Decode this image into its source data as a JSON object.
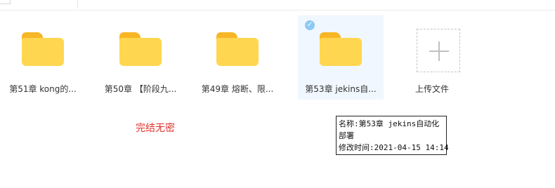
{
  "items": [
    {
      "label": "第51章 kong的..."
    },
    {
      "label": "第50章 【阶段九..."
    },
    {
      "label": "第49章 熔断、限..."
    },
    {
      "label": "第53章 jekins自...",
      "selected": true
    }
  ],
  "upload": {
    "label": "上传文件"
  },
  "note": "完结无密",
  "tooltip": {
    "name_line1": "名称:第53章 jekins自动化",
    "name_line2": "部署",
    "modified": "修改时间:2021-04-15 14:14"
  },
  "colors": {
    "folder_body": "#ffd64f",
    "folder_tab": "#f7b625",
    "selection_bg": "#f0f7ff",
    "check": "#8cc9f5",
    "note_red": "#e0322a"
  },
  "icons": {
    "folder": "folder-icon",
    "check": "check-circle-icon",
    "upload": "plus-icon"
  }
}
